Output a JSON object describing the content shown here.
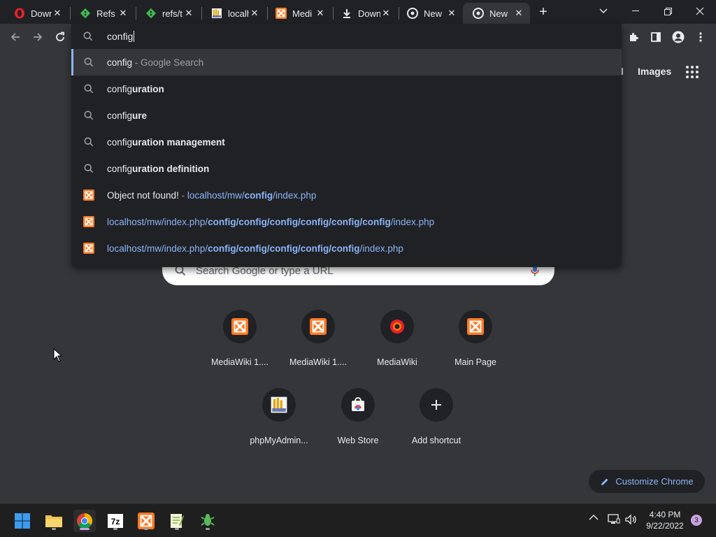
{
  "tabs": [
    {
      "title": "Down",
      "favicon": "opera-icon"
    },
    {
      "title": "Refs ·",
      "favicon": "git-icon"
    },
    {
      "title": "refs/t",
      "favicon": "git-icon"
    },
    {
      "title": "localh",
      "favicon": "pma-icon"
    },
    {
      "title": "Medi",
      "favicon": "xampp-icon"
    },
    {
      "title": "Down",
      "favicon": "download-icon"
    },
    {
      "title": "New",
      "favicon": "chrome-icon"
    },
    {
      "title": "New",
      "favicon": "chrome-icon"
    }
  ],
  "omnibox": {
    "input_value": "config",
    "suggestions": [
      {
        "icon": "search-icon",
        "pre": "config",
        "bold": "",
        "suffix": " - Google Search",
        "type": "search"
      },
      {
        "icon": "search-icon",
        "pre": "config",
        "bold": "uration",
        "suffix": "",
        "type": "search"
      },
      {
        "icon": "search-icon",
        "pre": "config",
        "bold": "ure",
        "suffix": "",
        "type": "search"
      },
      {
        "icon": "search-icon",
        "pre": "config",
        "bold": "uration management",
        "suffix": "",
        "type": "search"
      },
      {
        "icon": "search-icon",
        "pre": "config",
        "bold": "uration definition",
        "suffix": "",
        "type": "search"
      },
      {
        "icon": "xampp-icon",
        "title": "Object not found!",
        "sep": " - ",
        "url_parts": [
          "localhost/mw/",
          "config",
          "/index.php"
        ],
        "type": "history"
      },
      {
        "icon": "xampp-icon",
        "url_parts": [
          "localhost/mw/index.php/",
          "config/config/config/config/config/config",
          "/index.php"
        ],
        "type": "url"
      },
      {
        "icon": "xampp-icon",
        "url_parts": [
          "localhost/mw/index.php/",
          "config/config/config/config/config",
          "/index.php"
        ],
        "type": "url"
      }
    ]
  },
  "header": {
    "gmail": "il",
    "images": "Images"
  },
  "search": {
    "placeholder": "Search Google or type a URL"
  },
  "shortcuts": [
    {
      "label": "MediaWiki 1....",
      "icon": "xampp-icon"
    },
    {
      "label": "MediaWiki 1....",
      "icon": "xampp-icon"
    },
    {
      "label": "MediaWiki",
      "icon": "opera-icon"
    },
    {
      "label": "Main Page",
      "icon": "xampp-icon"
    },
    {
      "label": "phpMyAdmin...",
      "icon": "pma-icon"
    },
    {
      "label": "Web Store",
      "icon": "webstore-icon"
    },
    {
      "label": "Add shortcut",
      "icon": "plus-icon"
    }
  ],
  "customize": {
    "label": "Customize Chrome"
  },
  "taskbar": {
    "apps": [
      "windows-start-icon",
      "file-explorer-icon",
      "chrome-icon",
      "7zip-icon",
      "xampp-icon",
      "notepadpp-icon",
      "gecko-icon"
    ],
    "clock_time": "4:40 PM",
    "clock_date": "9/22/2022",
    "notification_count": "3"
  },
  "colors": {
    "background": "#35363a",
    "accent": "#8ab4f8",
    "omnibox": "#202124"
  }
}
